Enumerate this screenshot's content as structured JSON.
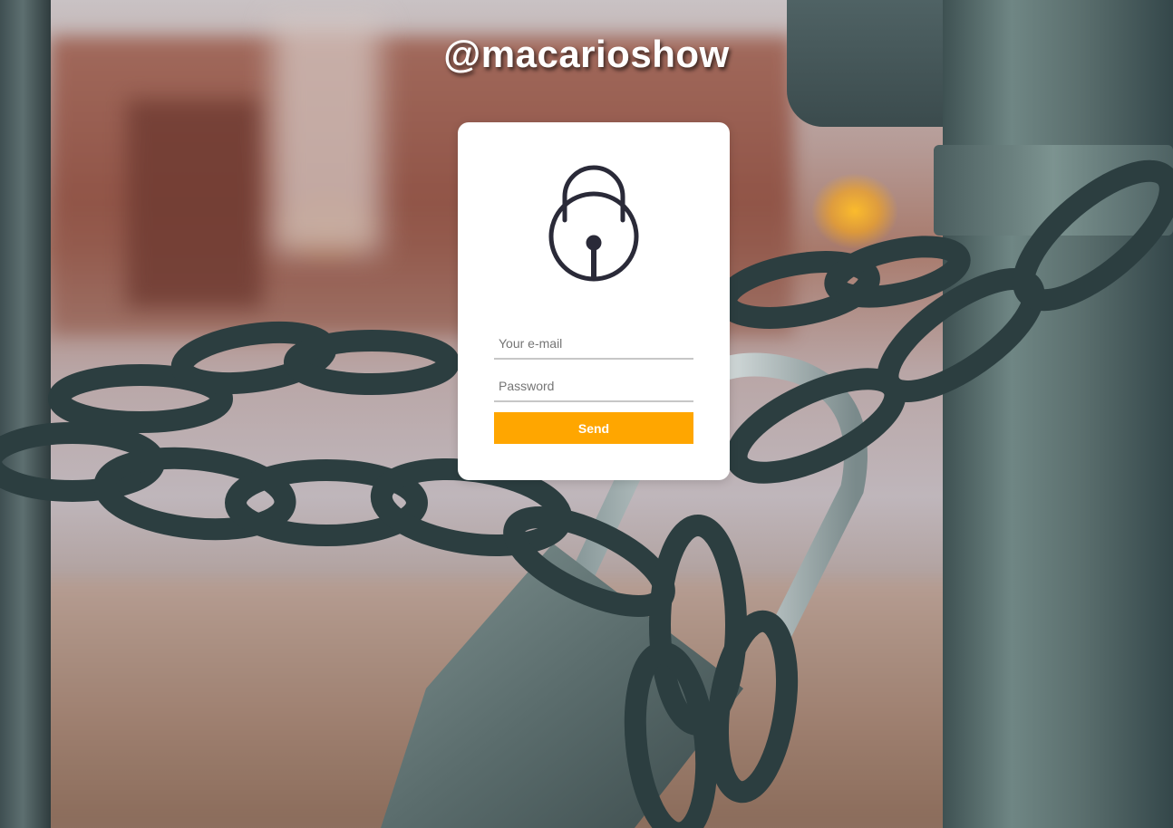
{
  "brand": {
    "title": "@macarioshow"
  },
  "login": {
    "email": {
      "placeholder": "Your e-mail",
      "value": ""
    },
    "password": {
      "placeholder": "Password",
      "value": ""
    },
    "send_label": "Send"
  },
  "icons": {
    "lock": "padlock-icon"
  },
  "colors": {
    "accent": "#ffa600",
    "card": "#ffffff",
    "icon": "#2a2a38",
    "title": "#ffffff"
  }
}
